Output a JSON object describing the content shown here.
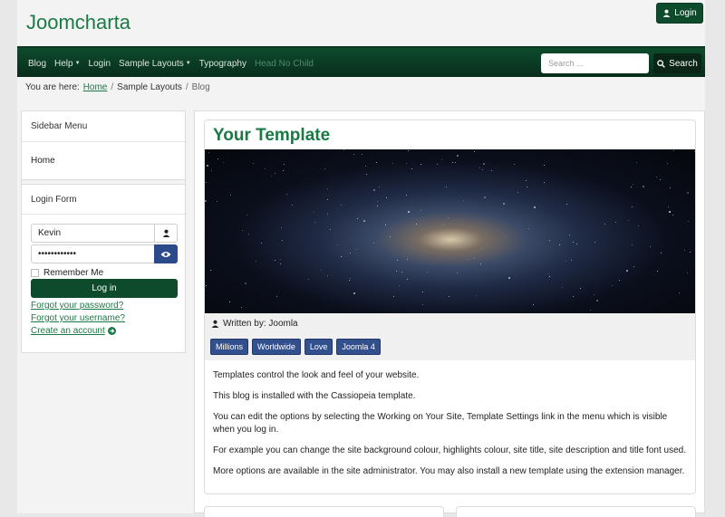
{
  "site": {
    "brand": "Joomcharta"
  },
  "header": {
    "login_label": "Login"
  },
  "nav": {
    "items": [
      {
        "label": "Blog",
        "has_caret": false,
        "dim": false
      },
      {
        "label": "Help",
        "has_caret": true,
        "dim": false
      },
      {
        "label": "Login",
        "has_caret": false,
        "dim": false
      },
      {
        "label": "Sample Layouts",
        "has_caret": true,
        "dim": false
      },
      {
        "label": "Typography",
        "has_caret": false,
        "dim": false
      },
      {
        "label": "Head No Child",
        "has_caret": false,
        "dim": true
      }
    ],
    "search_placeholder": "Search ...",
    "search_button": "Search"
  },
  "breadcrumb": {
    "prefix": "You are here:",
    "items": [
      "Home",
      "Sample Layouts",
      "Blog"
    ]
  },
  "sidebar": {
    "menu_title": "Sidebar Menu",
    "menu_items": [
      "Home"
    ],
    "login_title": "Login Form",
    "username_value": "Kevin",
    "password_value": "••••••••••••",
    "remember_label": "Remember Me",
    "login_button": "Log in",
    "forgot_password": "Forgot your password?",
    "forgot_username": "Forgot your username?",
    "create_account": "Create an account"
  },
  "article": {
    "title": "Your Template",
    "author": "Written by: Joomla",
    "tags": [
      "Millions",
      "Worldwide",
      "Love",
      "Joomla 4"
    ],
    "paragraphs": [
      "Templates control the look and feel of your website.",
      "This blog is installed with the Cassiopeia template.",
      "You can edit the options by selecting the Working on Your Site, Template Settings link in the menu which is visible when you log in.",
      "For example you can change the site background colour, highlights colour, site title, site description and title font used.",
      "More options are available in the site administrator. You may also install a new template using the extension manager."
    ]
  },
  "colors": {
    "brand": "#1a7a45",
    "navbar": "#0e4b2d",
    "tag": "#33508e"
  }
}
